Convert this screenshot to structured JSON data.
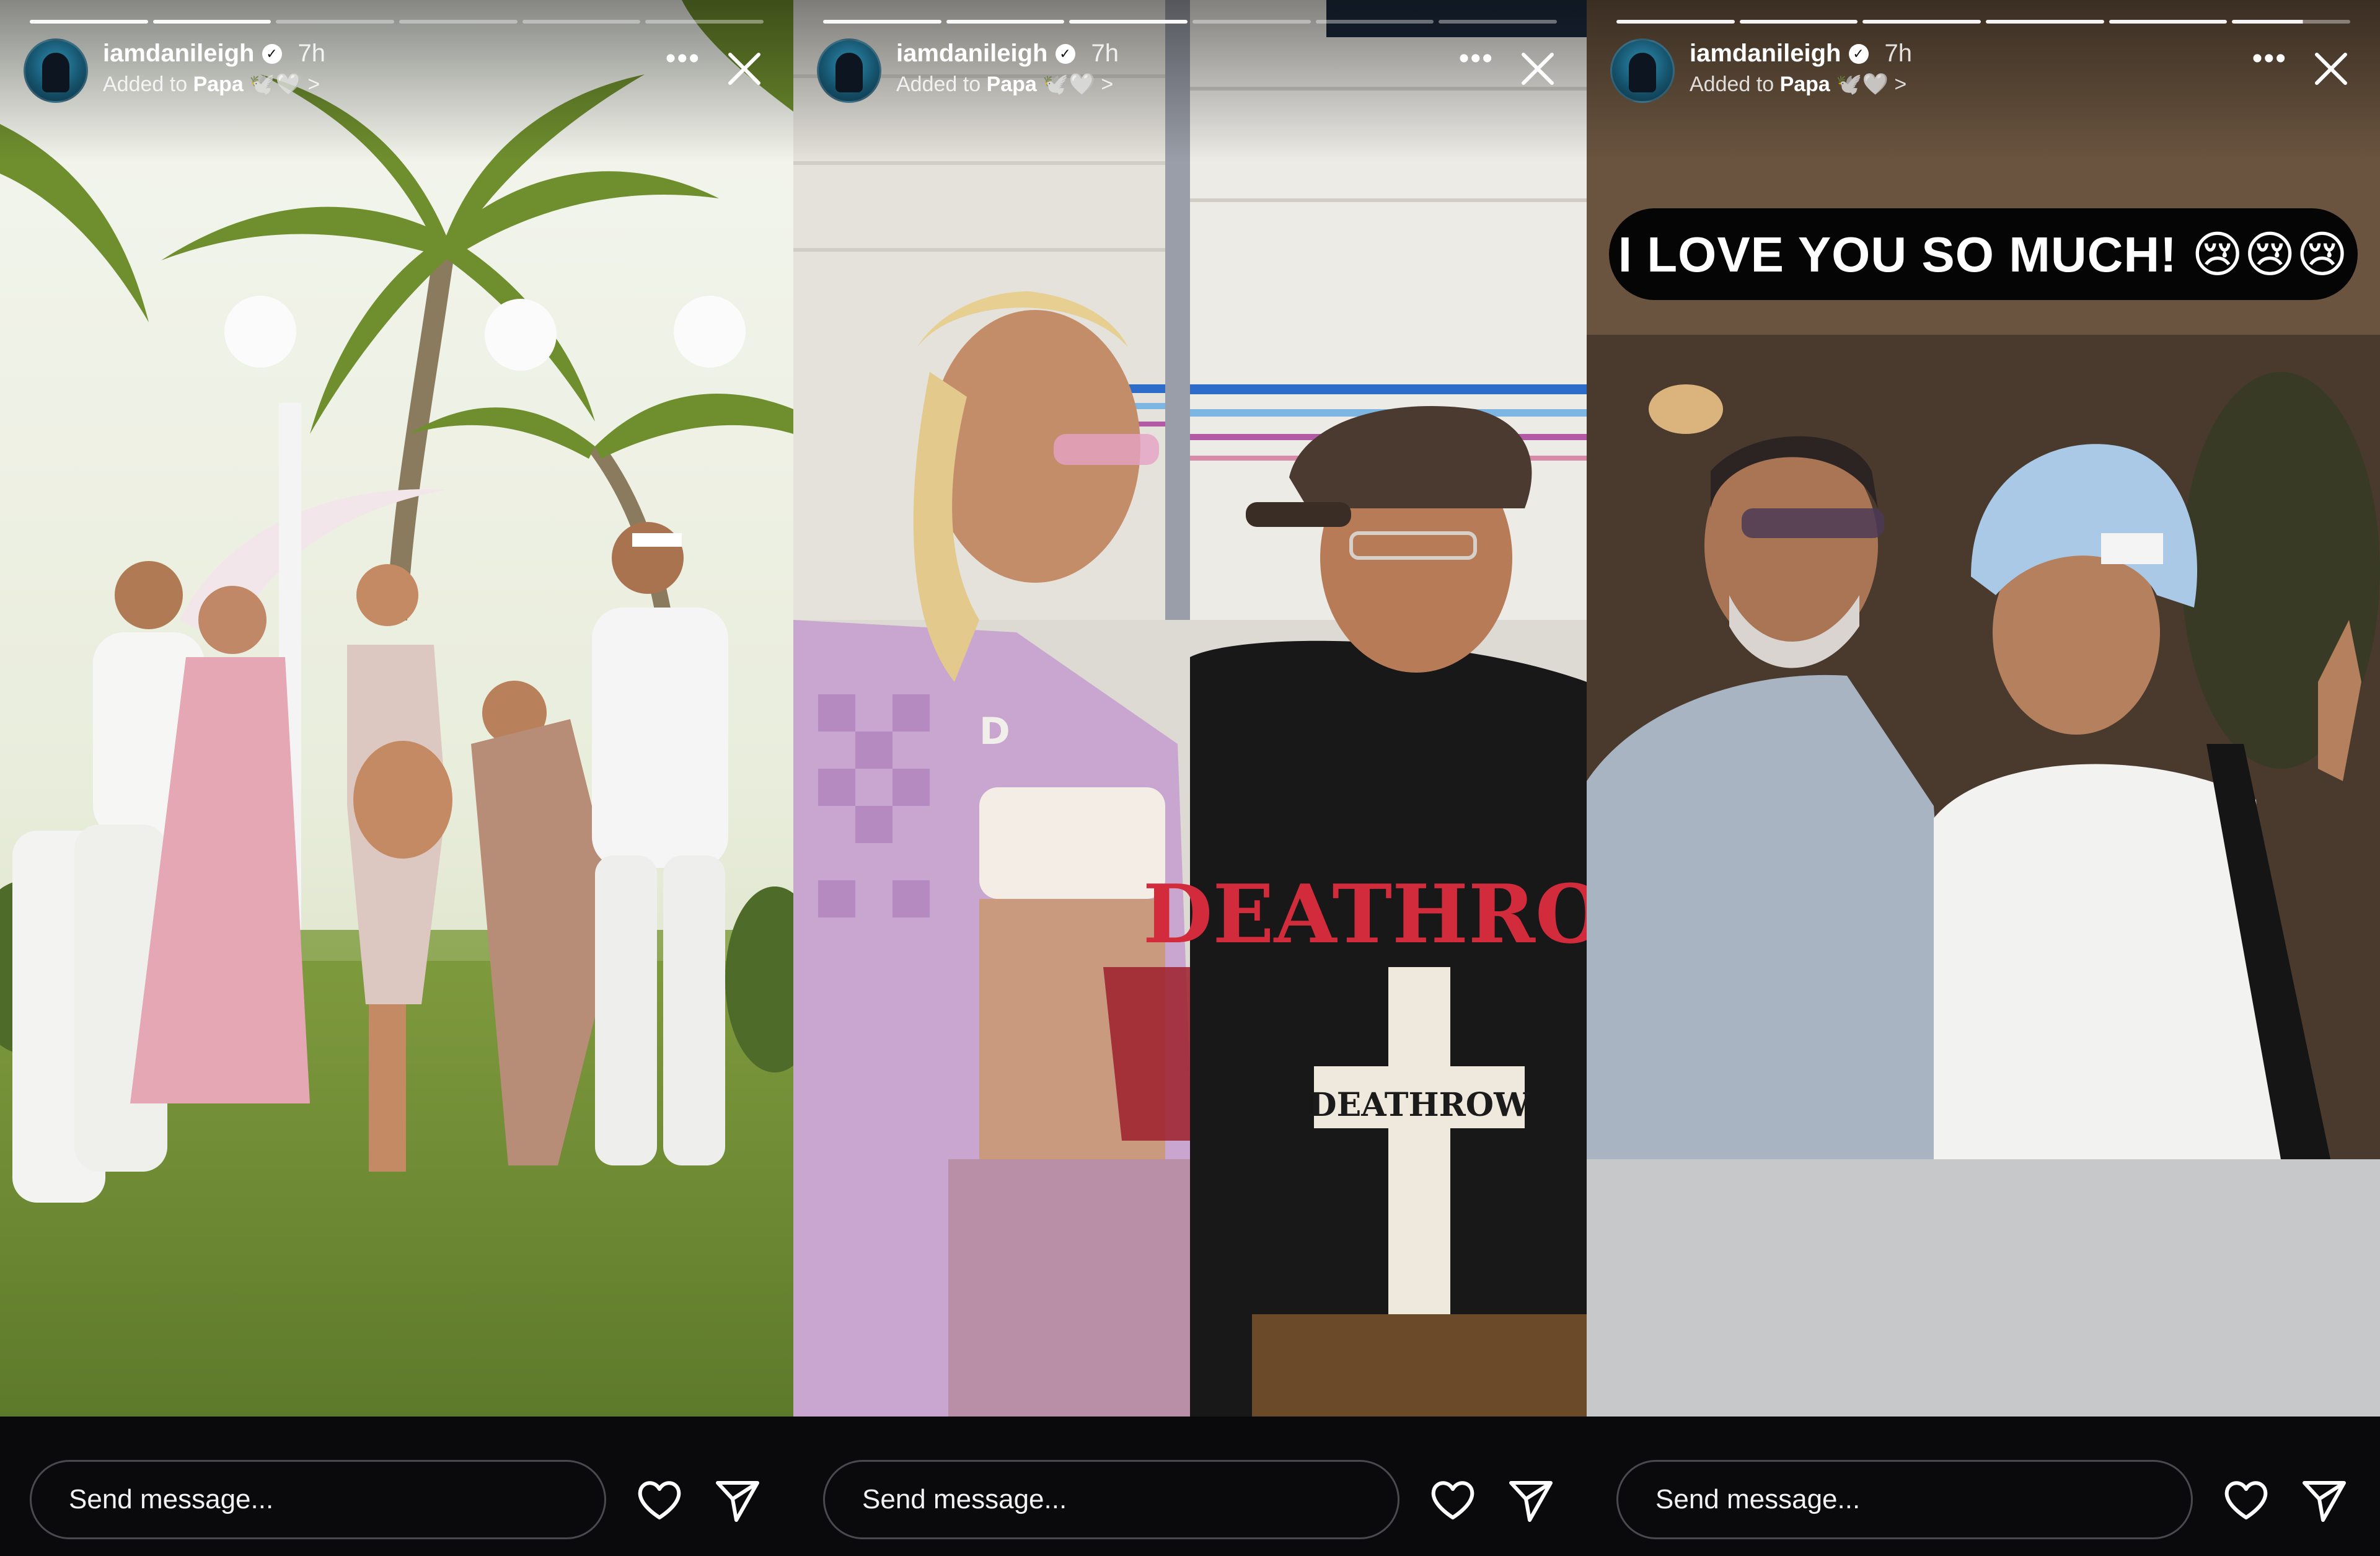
{
  "stories": [
    {
      "username": "iamdanileigh",
      "verified_icon": "verified-badge-icon",
      "time": "7h",
      "added_prefix": "Added to",
      "highlight_name": "Papa",
      "highlight_emoji": "🕊️🤍",
      "chevron": ">",
      "caption": "",
      "message_placeholder": "Send message..."
    },
    {
      "username": "iamdanileigh",
      "verified_icon": "verified-badge-icon",
      "time": "7h",
      "added_prefix": "Added to",
      "highlight_name": "Papa",
      "highlight_emoji": "🕊️🤍",
      "chevron": ">",
      "caption": "",
      "message_placeholder": "Send message..."
    },
    {
      "username": "iamdanileigh",
      "verified_icon": "verified-badge-icon",
      "time": "7h",
      "added_prefix": "Added to",
      "highlight_name": "Papa",
      "highlight_emoji": "🕊️🤍",
      "chevron": ">",
      "caption": "I LOVE YOU SO MUCH! 😢😢😢",
      "message_placeholder": "Send message..."
    }
  ],
  "photo_text": {
    "shirt_top": "DEATHROW",
    "shirt_cross": "DEATHROW",
    "pendant": "D"
  },
  "icons": {
    "more": "more-options-icon",
    "close": "close-icon",
    "like": "heart-icon",
    "share": "send-icon"
  },
  "colors": {
    "background": "#0a0a0c",
    "text": "#ffffff",
    "input_border": "#4a4a4e"
  }
}
